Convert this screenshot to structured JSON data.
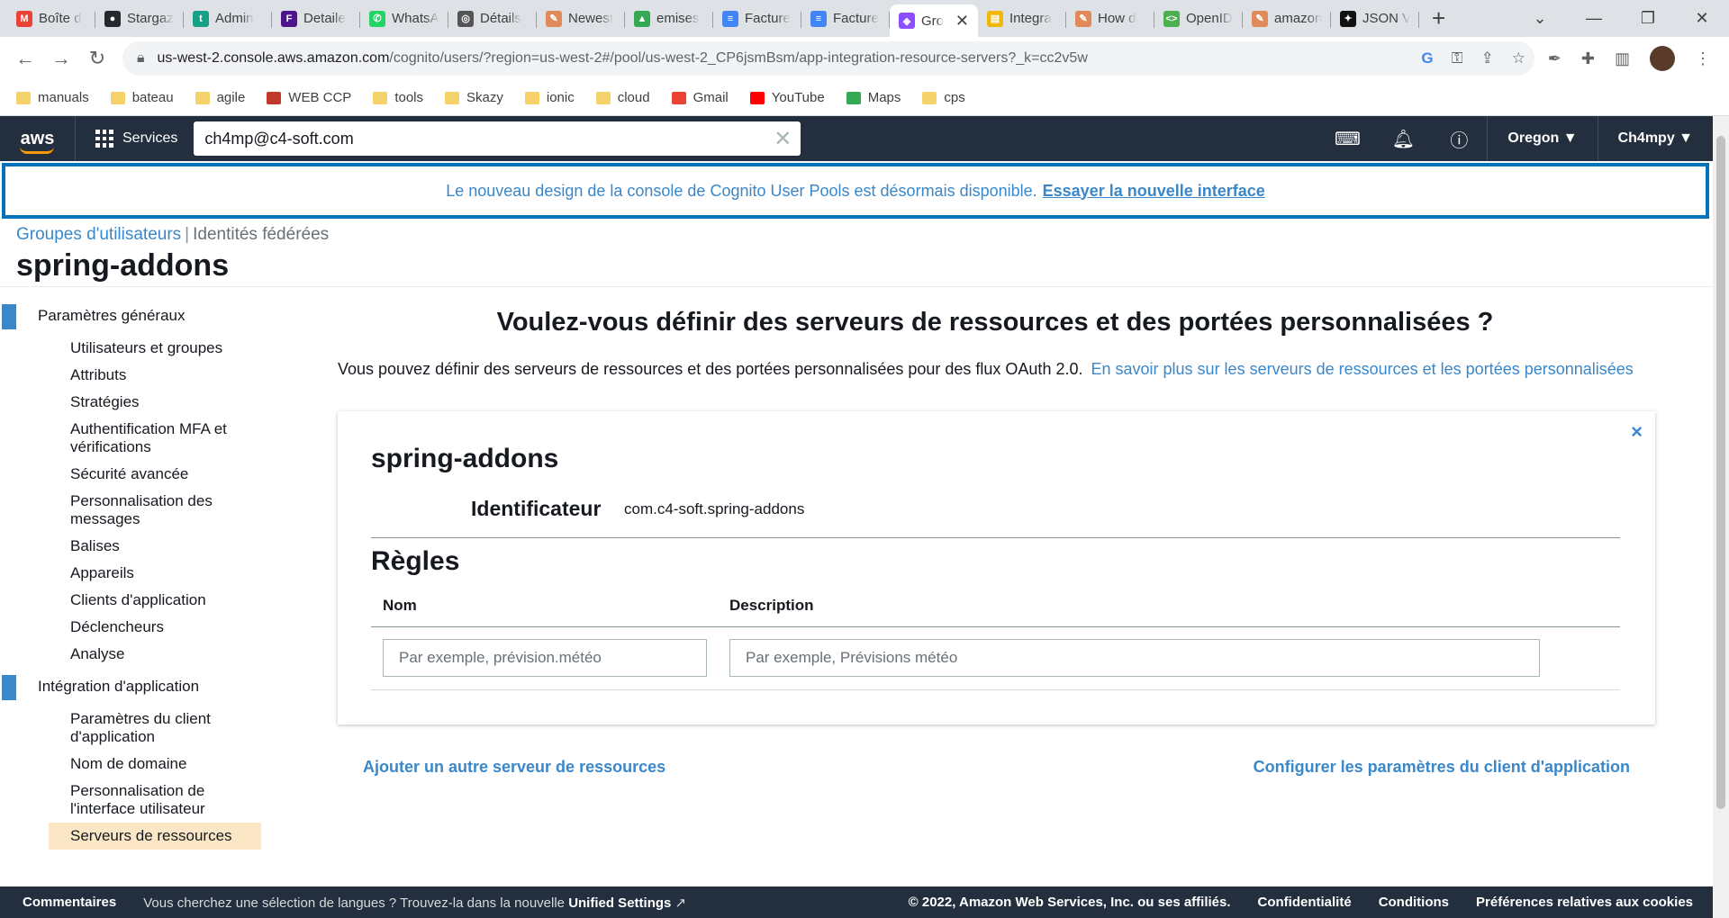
{
  "browser": {
    "tabs": [
      {
        "label": "Boîte d",
        "icon": "gmail-icon",
        "color": "#ea4335",
        "glyph": "M"
      },
      {
        "label": "Stargaz",
        "icon": "github-icon",
        "color": "#24292e",
        "glyph": "●"
      },
      {
        "label": "Admin",
        "icon": "admin-icon",
        "color": "#16a085",
        "glyph": "t"
      },
      {
        "label": "Detaile",
        "icon": "fedex-icon",
        "color": "#4d148c",
        "glyph": "F"
      },
      {
        "label": "WhatsA",
        "icon": "whatsapp-icon",
        "color": "#25d366",
        "glyph": "✆"
      },
      {
        "label": "Détails",
        "icon": "seal-icon",
        "color": "#555555",
        "glyph": "◎"
      },
      {
        "label": "Newest",
        "icon": "pencil-icon",
        "color": "#e08a5a",
        "glyph": "✎"
      },
      {
        "label": "emises",
        "icon": "drive-icon",
        "color": "#34a853",
        "glyph": "▲"
      },
      {
        "label": "Facture",
        "icon": "docs-icon",
        "color": "#4285f4",
        "glyph": "≡"
      },
      {
        "label": "Facture",
        "icon": "docs-icon",
        "color": "#4285f4",
        "glyph": "≡"
      },
      {
        "label": "Gro",
        "icon": "cognito-icon",
        "color": "#8c4fff",
        "glyph": "◈",
        "active": true
      },
      {
        "label": "Integra",
        "icon": "notes-icon",
        "color": "#f2b705",
        "glyph": "▤"
      },
      {
        "label": "How d",
        "icon": "pencil-icon",
        "color": "#e08a5a",
        "glyph": "✎"
      },
      {
        "label": "OpenID",
        "icon": "openid-icon",
        "color": "#4caf50",
        "glyph": "<>"
      },
      {
        "label": "amazon",
        "icon": "pencil-icon",
        "color": "#e08a5a",
        "glyph": "✎"
      },
      {
        "label": "JSON V",
        "icon": "json-icon",
        "color": "#111111",
        "glyph": "✦"
      }
    ],
    "url_domain": "us-west-2.console.aws.amazon.com",
    "url_path": "/cognito/users/?region=us-west-2#/pool/us-west-2_CP6jsmBsm/app-integration-resource-servers?_k=cc2v5w",
    "bookmarks": [
      {
        "label": "manuals",
        "icon": "folder-icon"
      },
      {
        "label": "bateau",
        "icon": "folder-icon"
      },
      {
        "label": "agile",
        "icon": "folder-icon"
      },
      {
        "label": "WEB CCP",
        "icon": "ccp-icon"
      },
      {
        "label": "tools",
        "icon": "folder-icon"
      },
      {
        "label": "Skazy",
        "icon": "folder-icon"
      },
      {
        "label": "ionic",
        "icon": "folder-icon"
      },
      {
        "label": "cloud",
        "icon": "folder-icon"
      },
      {
        "label": "Gmail",
        "icon": "gmail-icon"
      },
      {
        "label": "YouTube",
        "icon": "youtube-icon"
      },
      {
        "label": "Maps",
        "icon": "maps-icon"
      },
      {
        "label": "cps",
        "icon": "folder-icon"
      }
    ]
  },
  "aws": {
    "services_label": "Services",
    "search_value": "ch4mp@c4-soft.com",
    "region": "Oregon",
    "account": "Ch4mpy"
  },
  "banner": {
    "text": "Le nouveau design de la console de Cognito User Pools est désormais disponible.",
    "link": "Essayer la nouvelle interface"
  },
  "breadcrumb": {
    "pools": "Groupes d'utilisateurs",
    "separator": "|",
    "federated": "Identités fédérées"
  },
  "pool_name": "spring-addons",
  "sidebar": {
    "general_section": "Paramètres généraux",
    "general_items": [
      "Utilisateurs et groupes",
      "Attributs",
      "Stratégies",
      "Authentification MFA et vérifications",
      "Sécurité avancée",
      "Personnalisation des messages",
      "Balises",
      "Appareils",
      "Clients d'application",
      "Déclencheurs",
      "Analyse"
    ],
    "integration_section": "Intégration d'application",
    "integration_items": [
      "Paramètres du client d'application",
      "Nom de domaine",
      "Personnalisation de l'interface utilisateur",
      "Serveurs de ressources"
    ]
  },
  "main": {
    "heading": "Voulez-vous définir des serveurs de ressources et des portées personnalisées ?",
    "intro": "Vous pouvez définir des serveurs de ressources et des portées personnalisées pour des flux OAuth 2.0.",
    "intro_link": "En savoir plus sur les serveurs de ressources et les portées personnalisées",
    "card": {
      "title": "spring-addons",
      "identifier_label": "Identificateur",
      "identifier_value": "com.c4-soft.spring-addons",
      "rules_title": "Règles",
      "col_name": "Nom",
      "col_description": "Description",
      "name_placeholder": "Par exemple, prévision.météo",
      "description_placeholder": "Par exemple, Prévisions météo",
      "close": "×"
    },
    "add_server": "Ajouter un autre serveur de ressources",
    "configure_client": "Configurer les paramètres du client d'application"
  },
  "footer": {
    "comments": "Commentaires",
    "lang_question": "Vous cherchez une sélection de langues ? Trouvez-la dans la nouvelle",
    "unified": "Unified Settings",
    "copyright": "© 2022, Amazon Web Services, Inc. ou ses affiliés.",
    "privacy": "Confidentialité",
    "terms": "Conditions",
    "cookies": "Préférences relatives aux cookies"
  },
  "colors": {
    "aws_nav": "#232f3e",
    "link": "#3a87c9",
    "accent": "#ff9900",
    "active_item": "#fbe7c6"
  }
}
